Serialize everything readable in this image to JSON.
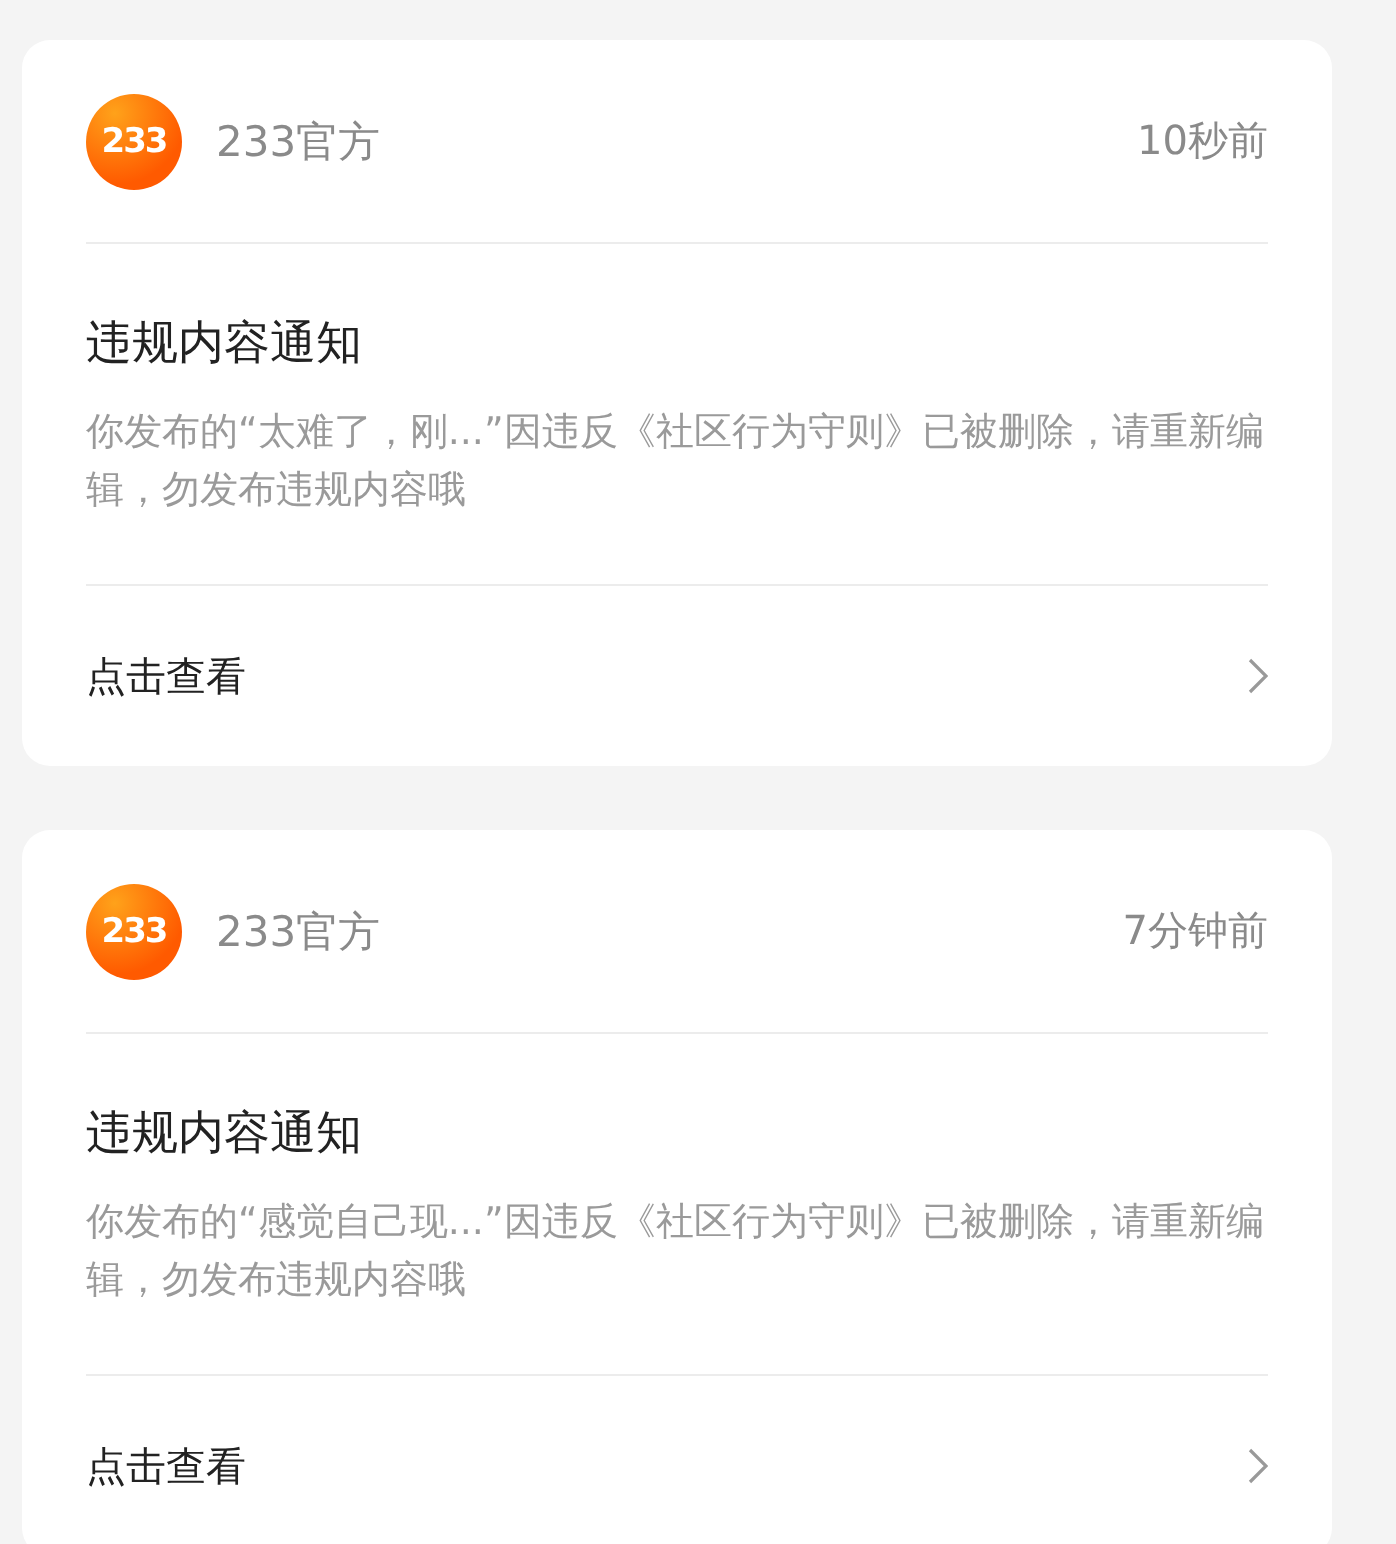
{
  "notifications": [
    {
      "logo_text": "233",
      "sender": "233官方",
      "time": "10秒前",
      "title": "违规内容通知",
      "body": "你发布的“太难了，刚...”因违反《社区行为守则》已被删除，请重新编辑，勿发布违规内容哦",
      "action": "点击查看"
    },
    {
      "logo_text": "233",
      "sender": "233官方",
      "time": "7分钟前",
      "title": "违规内容通知",
      "body": "你发布的“感觉自己现...”因违反《社区行为守则》已被删除，请重新编辑，勿发布违规内容哦",
      "action": "点击查看"
    }
  ]
}
